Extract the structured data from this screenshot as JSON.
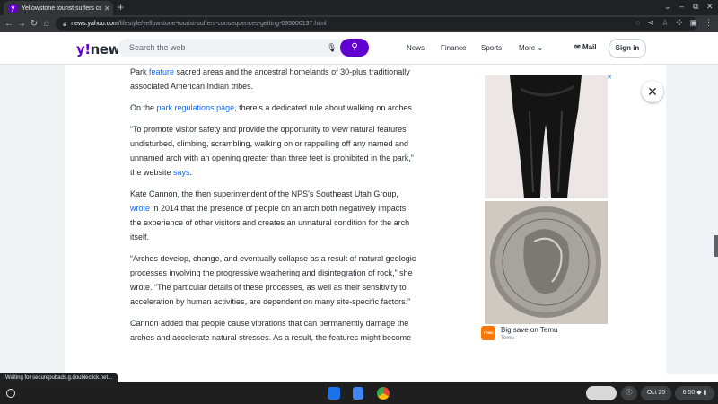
{
  "browser": {
    "tab_title": "Yellowstone tourist suffers conseq...",
    "url_host": "news.yahoo.com",
    "url_path": "/lifestyle/yellowstone-tourist-suffers-consequences-getting-093000137.html"
  },
  "header": {
    "logo_y": "y!",
    "logo_news": "news",
    "search_placeholder": "Search the web",
    "nav": [
      "News",
      "Finance",
      "Sports",
      "More"
    ],
    "mail_label": "Mail",
    "signin_label": "Sign in"
  },
  "article": {
    "p1": {
      "a": "Park ",
      "link": "feature",
      "b": " sacred areas and the ancestral homelands of 30-plus traditionally associated American Indian tribes."
    },
    "p2": {
      "a": "On the ",
      "link": "park regulations page",
      "b": ", there's a dedicated rule about walking on arches."
    },
    "p3": {
      "a": "“To promote visitor safety and provide the opportunity to view natural features undisturbed, climbing, scrambling, walking on or rappelling off any named and unnamed arch with an opening greater than three feet is prohibited in the park,” the website ",
      "link": "says",
      "b": "."
    },
    "p4": {
      "a": "Kate Cannon, the then superintendent of the NPS's Southeast Utah Group, ",
      "link": "wrote",
      "b": " in 2014 that the presence of people on an arch both negatively impacts the experience of other visitors and creates an unnatural condition for the arch itself."
    },
    "p5": "“Arches develop, change, and eventually collapse as a result of natural geologic processes involving the progressive weathering and disintegration of rock,”  she wrote. “The particular details of these processes, as well as their sensitivity to acceleration by human activities, are dependent on many site-specific factors.”",
    "p6": "Cannon added that people cause vibrations that can permanently damage the arches and accelerate natural stresses. As a result, the features might become"
  },
  "ad": {
    "choices": "▷ ✕",
    "title": "Big save on Temu",
    "advertiser": "Temu",
    "logo_text": "TEMU"
  },
  "status_text": "Waiting for securepubads.g.doubleclick.net...",
  "shelf": {
    "date": "Oct 25",
    "time": "6:50"
  }
}
